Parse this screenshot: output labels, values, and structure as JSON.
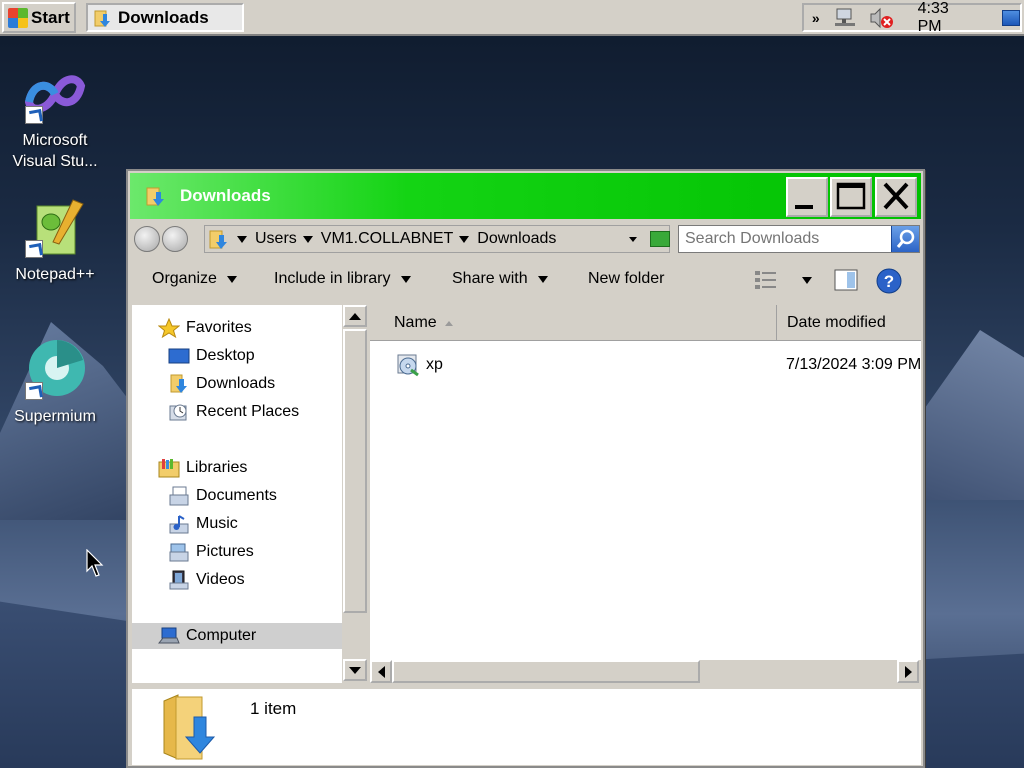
{
  "taskbar": {
    "start_label": "Start",
    "active_task": "Downloads",
    "clock": "4:33 PM",
    "tray_chevron": "»"
  },
  "desktop_icons": [
    {
      "label": "Microsoft Visual Stu...",
      "icon": "visual-studio-icon"
    },
    {
      "label": "Notepad++",
      "icon": "notepad-plus-plus-icon"
    },
    {
      "label": "Supermium",
      "icon": "supermium-browser-icon"
    }
  ],
  "window": {
    "title": "Downloads",
    "titlebar_color": "#00c000",
    "address": {
      "crumbs": [
        "Users",
        "VM1.COLLABNET",
        "Downloads"
      ]
    },
    "search": {
      "placeholder": "Search Downloads"
    },
    "commands": {
      "organize": "Organize",
      "include_in_library": "Include in library",
      "share_with": "Share with",
      "new_folder": "New folder"
    },
    "nav": {
      "favorites_header": "Favorites",
      "favorites": [
        "Desktop",
        "Downloads",
        "Recent Places"
      ],
      "libraries_header": "Libraries",
      "libraries": [
        "Documents",
        "Music",
        "Pictures",
        "Videos"
      ],
      "computer": "Computer"
    },
    "columns": {
      "name": "Name",
      "date_modified": "Date modified"
    },
    "files": [
      {
        "name": "xp",
        "date_modified": "7/13/2024 3:09 PM",
        "icon": "disc-image-icon"
      }
    ],
    "status": {
      "item_count": "1 item"
    }
  }
}
